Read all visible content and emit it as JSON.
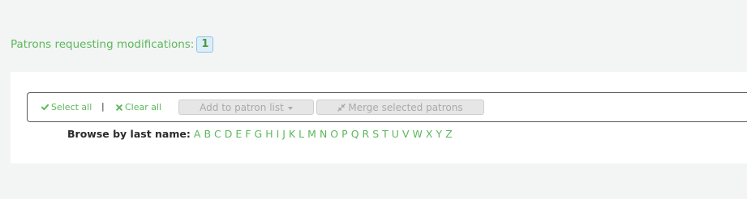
{
  "modifications": {
    "label": "Patrons requesting modifications:",
    "count": "1"
  },
  "toolbar": {
    "select_all": "Select all",
    "separator": "|",
    "clear_all": "Clear all",
    "add_to_list": "Add to patron list",
    "merge": "Merge selected patrons"
  },
  "browse": {
    "label": "Browse by last name:",
    "letters": [
      "A",
      "B",
      "C",
      "D",
      "E",
      "F",
      "G",
      "H",
      "I",
      "J",
      "K",
      "L",
      "M",
      "N",
      "O",
      "P",
      "Q",
      "R",
      "S",
      "T",
      "U",
      "V",
      "W",
      "X",
      "Y",
      "Z"
    ]
  },
  "colors": {
    "link_green": "#5cb85c",
    "page_bg": "#f3f4f4",
    "badge_border": "#8ec2e5",
    "disabled_button": "#e6e6e6"
  }
}
